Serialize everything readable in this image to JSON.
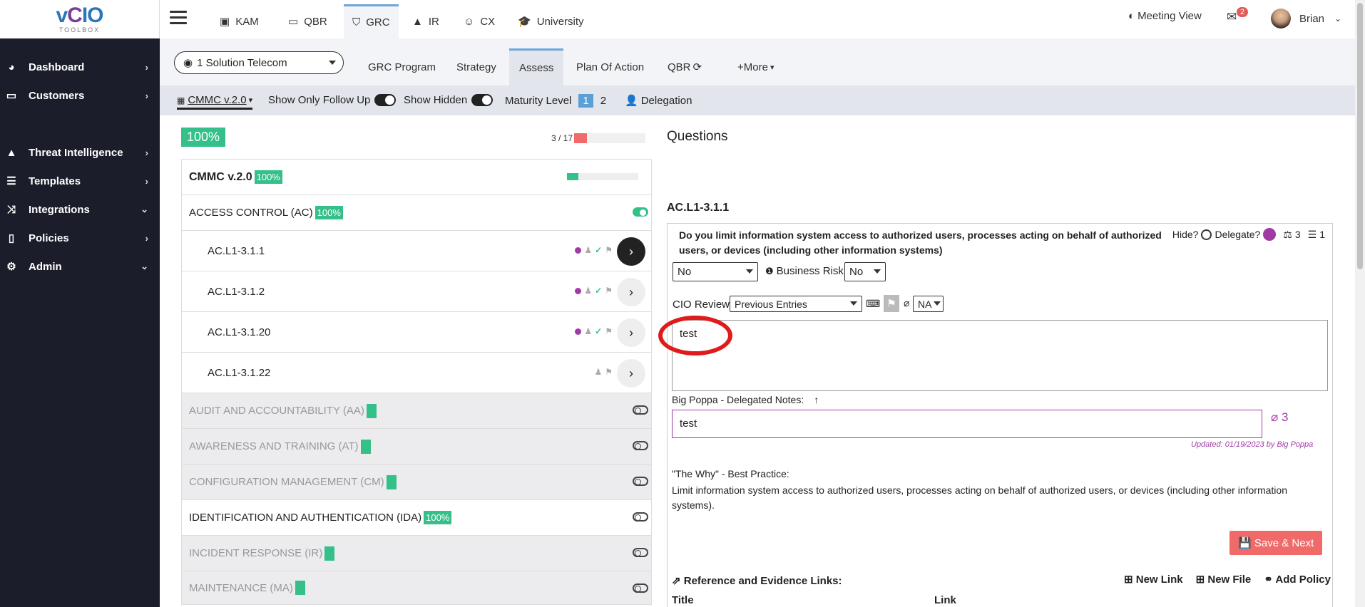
{
  "logo": {
    "main_a": "v",
    "main_b": "C",
    "main_c": "IO",
    "sub": "TOOLBOX"
  },
  "sidebar": {
    "items": [
      {
        "label": "Dashboard",
        "arrow": "›"
      },
      {
        "label": "Customers",
        "arrow": "›"
      },
      {
        "label": "Threat Intelligence",
        "arrow": "›"
      },
      {
        "label": "Templates",
        "arrow": "›"
      },
      {
        "label": "Integrations",
        "arrow": "⌄"
      },
      {
        "label": "Policies",
        "arrow": "›"
      },
      {
        "label": "Admin",
        "arrow": "⌄"
      }
    ]
  },
  "topbar": {
    "tabs": [
      {
        "label": "KAM",
        "icon": "id-card-icon"
      },
      {
        "label": "QBR",
        "icon": "laptop-icon"
      },
      {
        "label": "GRC",
        "icon": "shield-icon"
      },
      {
        "label": "IR",
        "icon": "warning-icon"
      },
      {
        "label": "CX",
        "icon": "smile-icon"
      },
      {
        "label": "University",
        "icon": "graduation-cap-icon"
      }
    ],
    "meeting_view": "Meeting View",
    "mail_count": "2",
    "user_name": "Brian"
  },
  "subnav": {
    "client": "1 Solution Telecom",
    "tabs": [
      "GRC Program",
      "Strategy",
      "Assess",
      "Plan Of Action",
      "QBR",
      "+More"
    ]
  },
  "toolrow": {
    "framework": "CMMC v.2.0",
    "follow_up": "Show Only Follow Up",
    "hidden": "Show Hidden",
    "maturity": "Maturity Level",
    "level1": "1",
    "level2": "2",
    "delegation": "Delegation"
  },
  "summary": {
    "percent": "100%",
    "progress_text": "3 / 17",
    "progress_fraction": 0.176
  },
  "tree": {
    "root": {
      "label": "CMMC v.2.0",
      "badge": "100%",
      "progress_fraction": 0.16
    },
    "ac": {
      "label": "ACCESS CONTROL (AC)",
      "badge": "100%"
    },
    "controls": [
      "AC.L1-3.1.1",
      "AC.L1-3.1.2",
      "AC.L1-3.1.20",
      "AC.L1-3.1.22"
    ],
    "sections": [
      {
        "label": "AUDIT AND ACCOUNTABILITY (AA)",
        "badge": "",
        "grey": true
      },
      {
        "label": "AWARENESS AND TRAINING (AT)",
        "badge": "",
        "grey": true
      },
      {
        "label": "CONFIGURATION MANAGEMENT (CM)",
        "badge": "",
        "grey": true
      },
      {
        "label": "IDENTIFICATION AND AUTHENTICATION (IDA)",
        "badge": "100%",
        "grey": false
      },
      {
        "label": "INCIDENT RESPONSE (IR)",
        "badge": "",
        "grey": true
      },
      {
        "label": "MAINTENANCE (MA)",
        "badge": "",
        "grey": true
      }
    ]
  },
  "question": {
    "heading": "Questions",
    "id": "AC.L1-3.1.1",
    "text": "Do you limit information system access to authorized users, processes acting on behalf of authorized users, or devices (including other information systems)",
    "hide": "Hide?",
    "delegate": "Delegate?",
    "scale_count": "3",
    "list_count": "1",
    "answer": "No",
    "business_risk_label": "Business Risk:",
    "business_risk": "No",
    "cio_review": "CIO Review",
    "previous_entries": "Previous Entries",
    "na": "NA",
    "notes": "test",
    "delegated_label": "Big Poppa - Delegated Notes:",
    "delegated_notes": "test",
    "attachment_count": "3",
    "updated": "Updated: 01/19/2023 by Big Poppa",
    "why_label": "\"The Why\" - Best Practice:",
    "why_text": "Limit information system access to authorized users, processes acting on behalf of authorized users, or devices (including other information systems).",
    "save_next": "Save & Next",
    "ref_title": "Reference and Evidence Links:",
    "new_link": "New Link",
    "new_file": "New File",
    "add_policy": "Add Policy",
    "col_title": "Title",
    "col_link": "Link"
  }
}
